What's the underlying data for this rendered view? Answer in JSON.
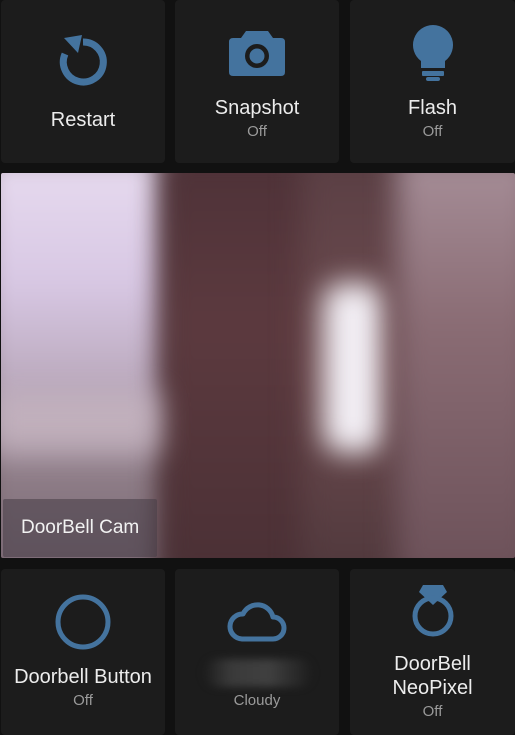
{
  "tiles_top": {
    "restart": {
      "name": "Restart",
      "icon": "restart-icon"
    },
    "snapshot": {
      "name": "Snapshot",
      "state": "Off",
      "icon": "camera-icon"
    },
    "flash": {
      "name": "Flash",
      "state": "Off",
      "icon": "lightbulb-icon"
    }
  },
  "camera": {
    "label": "DoorBell Cam"
  },
  "tiles_bottom": {
    "doorbell_button": {
      "name": "Doorbell Button",
      "state": "Off",
      "icon": "circle-outline-icon"
    },
    "weather": {
      "state": "Cloudy",
      "icon": "cloud-outline-icon"
    },
    "neopixel": {
      "name_line1": "DoorBell",
      "name_line2": "NeoPixel",
      "state": "Off",
      "icon": "diamond-ring-icon"
    }
  },
  "colors": {
    "icon_accent": "#44739e",
    "tile_bg": "#1c1c1c",
    "page_bg": "#111111",
    "text_primary": "#ececec",
    "text_secondary": "#9a9a9a"
  }
}
